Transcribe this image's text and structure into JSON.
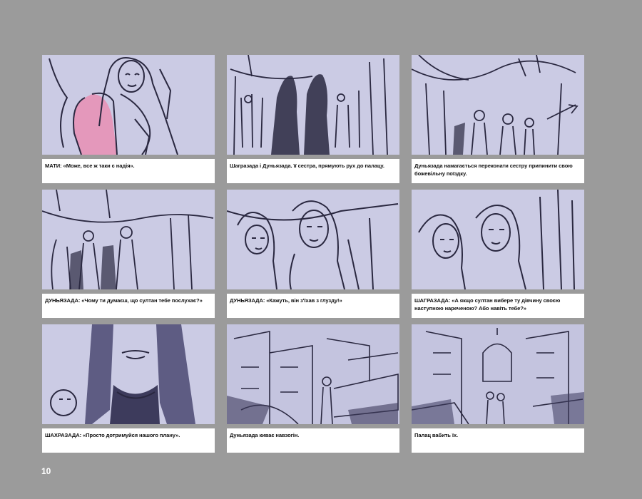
{
  "page_number": "10",
  "colors": {
    "background": "#9b9b9b",
    "sketch_bg": "#c9c9e2",
    "ink": "#2a2840",
    "accent_pink": "#e98fb4"
  },
  "panels": [
    {
      "speaker": "МАТИ:",
      "text": " «Може, все ж таки є надія»."
    },
    {
      "speaker": "",
      "text": "Шагразада і Дуньязада. її сестра, прямують рух до палацу."
    },
    {
      "speaker": "",
      "text": "Дуньязада намагається переконати сестру припинити свою божевільну поїздку."
    },
    {
      "speaker": "ДУНЬЯЗАДА:",
      "text": " «Чому ти думаєш, що султан тебе послухає?»"
    },
    {
      "speaker": "ДУНЬЯЗАДА:",
      "text": " «Кажуть, він з'їхав з глузду!»"
    },
    {
      "speaker": "ШАГРАЗАДА:",
      "text": " «А якщо султан вибере ту дівчину своєю наступною нареченою? Або навіть тебе?»"
    },
    {
      "speaker": "ШАХРАЗАДА:",
      "text": " «Просто дотримуйся нашого плану»."
    },
    {
      "speaker": "",
      "text": "Дуньязада киває навзогін."
    },
    {
      "speaker": "",
      "text": "Палац вабить їх."
    }
  ]
}
